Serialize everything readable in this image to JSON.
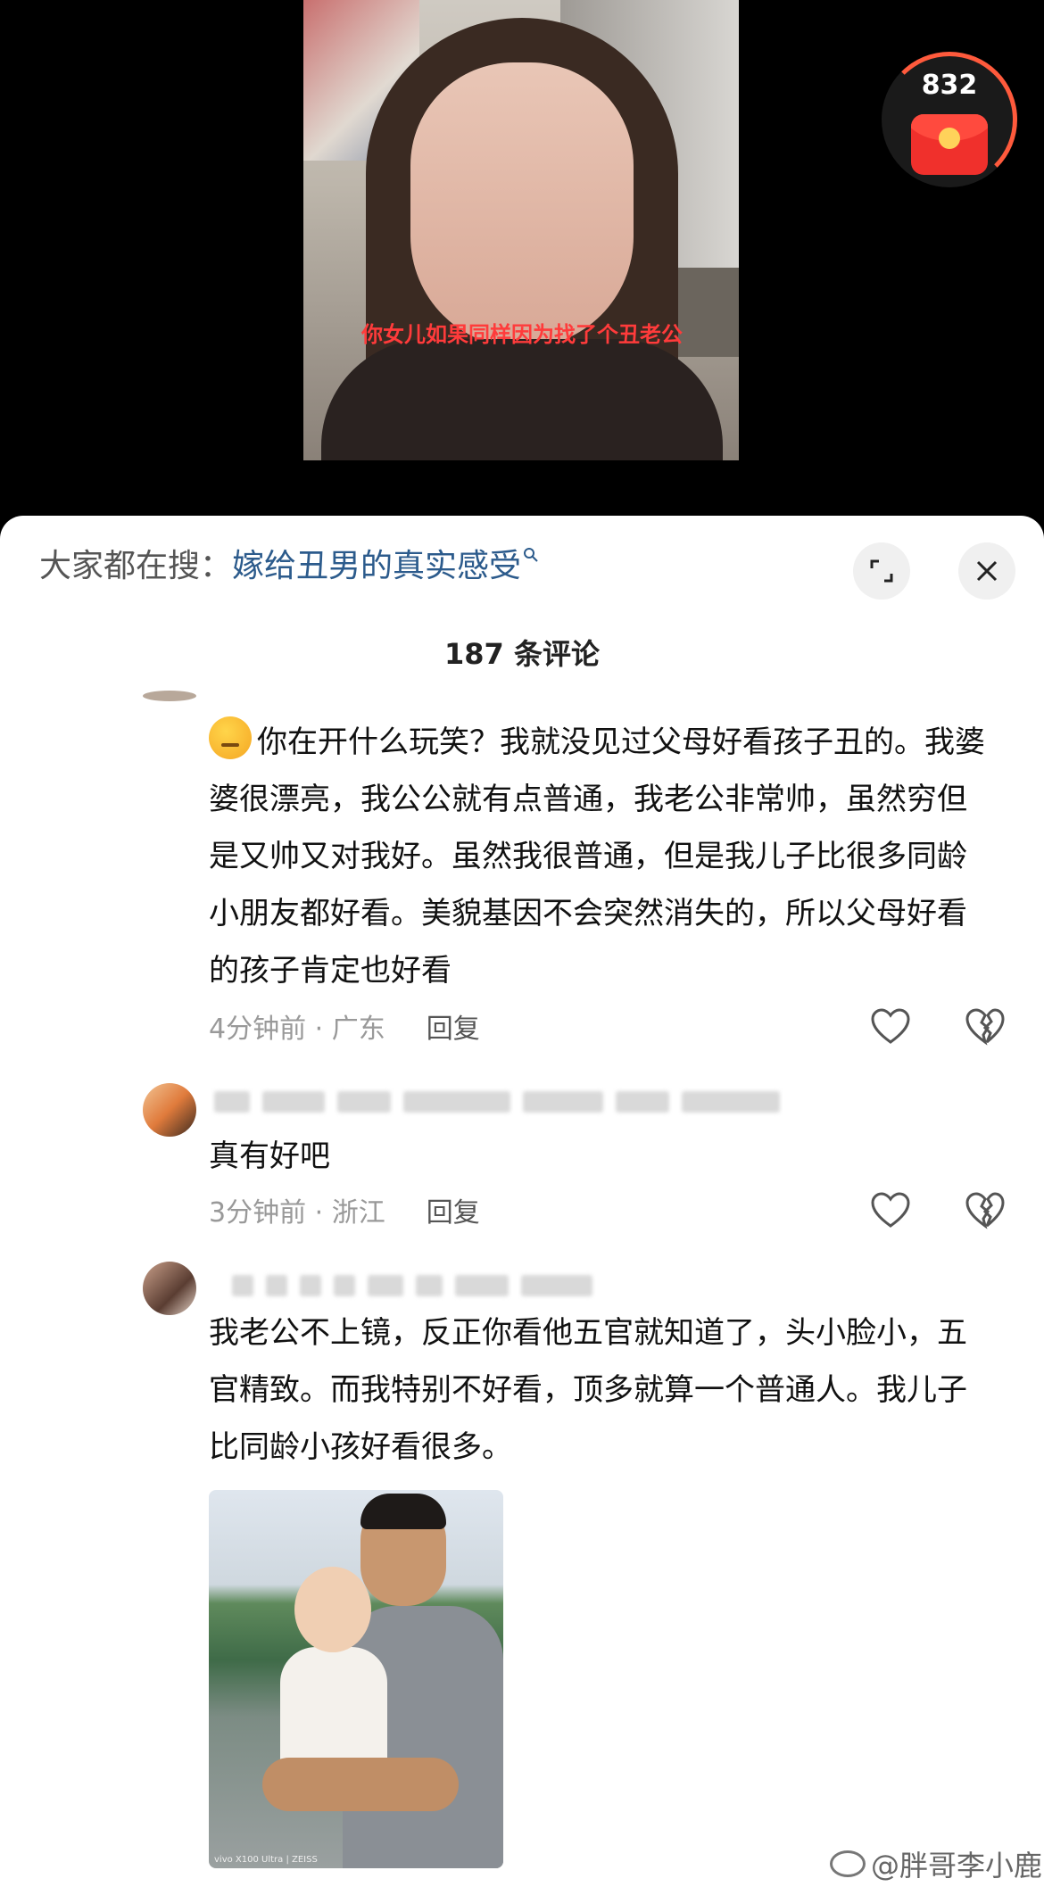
{
  "video": {
    "caption": "你女儿如果同样因为找了个丑老公",
    "redpacket_count": "832"
  },
  "search": {
    "prefix": "大家都在搜：",
    "term": "嫁给丑男的真实感受"
  },
  "comments_header": {
    "count_label": "187 条评论"
  },
  "comments": [
    {
      "text": "你在开什么玩笑？我就没见过父母好看孩子丑的。我婆婆很漂亮，我公公就有点普通，我老公非常帅，虽然穷但是又帅又对我好。虽然我很普通，但是我儿子比很多同龄小朋友都好看。美貌基因不会突然消失的，所以父母好看的孩子肯定也好看",
      "meta": "4分钟前 · 广东",
      "reply": "回复"
    },
    {
      "text": "真有好吧",
      "meta": "3分钟前 · 浙江",
      "reply": "回复"
    },
    {
      "text": "我老公不上镜，反正你看他五官就知道了，头小脸小，五官精致。而我特别不好看，顶多就算一个普通人。我儿子比同龄小孩好看很多。",
      "photo_caption": "vivo X100 Ultra | ZEISS"
    }
  ],
  "watermark": "@胖哥李小鹿",
  "colors": {
    "accent_link": "#2c5b8c",
    "caption_red": "#ff3b3b",
    "redpacket": "#f0302c"
  },
  "icons": [
    "expand-icon",
    "close-icon",
    "search-mini-icon",
    "heart-icon",
    "broken-heart-icon",
    "weibo-logo-icon"
  ]
}
